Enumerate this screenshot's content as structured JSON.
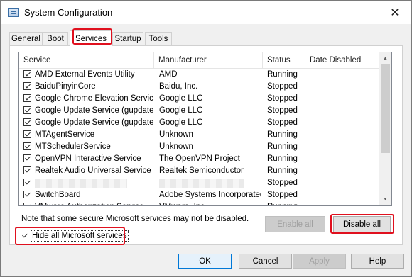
{
  "window": {
    "title": "System Configuration"
  },
  "tabs": [
    "General",
    "Boot",
    "Services",
    "Startup",
    "Tools"
  ],
  "list": {
    "columns": [
      "Service",
      "Manufacturer",
      "Status",
      "Date Disabled"
    ],
    "rows": [
      {
        "service": "AMD External Events Utility",
        "manufacturer": "AMD",
        "status": "Running"
      },
      {
        "service": "BaiduPinyinCore",
        "manufacturer": "Baidu, Inc.",
        "status": "Stopped"
      },
      {
        "service": "Google Chrome Elevation Servic...",
        "manufacturer": "Google LLC",
        "status": "Stopped"
      },
      {
        "service": "Google Update Service (gupdate)",
        "manufacturer": "Google LLC",
        "status": "Stopped"
      },
      {
        "service": "Google Update Service (gupdatem)",
        "manufacturer": "Google LLC",
        "status": "Stopped"
      },
      {
        "service": "MTAgentService",
        "manufacturer": "Unknown",
        "status": "Running"
      },
      {
        "service": "MTSchedulerService",
        "manufacturer": "Unknown",
        "status": "Running"
      },
      {
        "service": "OpenVPN Interactive Service",
        "manufacturer": "The OpenVPN Project",
        "status": "Running"
      },
      {
        "service": "Realtek Audio Universal Service",
        "manufacturer": "Realtek Semiconductor",
        "status": "Running"
      },
      {
        "service": "",
        "manufacturer": "",
        "status": "Stopped"
      },
      {
        "service": "SwitchBoard",
        "manufacturer": "Adobe Systems Incorporated",
        "status": "Stopped"
      },
      {
        "service": "VMware Authorization Service",
        "manufacturer": "VMware, Inc.",
        "status": "Running"
      }
    ]
  },
  "note": "Note that some secure Microsoft services may not be disabled.",
  "buttons": {
    "enable_all": "Enable all",
    "disable_all": "Disable all",
    "ok": "OK",
    "cancel": "Cancel",
    "apply": "Apply",
    "help": "Help"
  },
  "hide_ms": {
    "label": "Hide all Microsoft services",
    "checked": true
  },
  "colors": {
    "highlight": "#e0101e",
    "accent": "#0078d7"
  }
}
